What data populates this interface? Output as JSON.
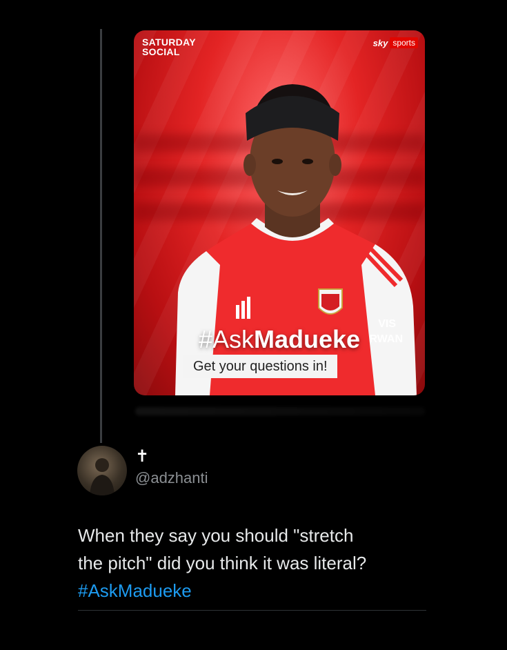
{
  "card": {
    "brand_line1": "SATURDAY",
    "brand_line2": "SOCIAL",
    "sky_label": "sky",
    "sports_label": "sports",
    "hashtag_prefix": "#Ask",
    "hashtag_name": "Madueke",
    "subtitle": "Get your questions in!",
    "shirt_sponsor": "VIS RWAN",
    "badge": "Arsenal"
  },
  "tweet": {
    "display_name": "✝",
    "handle": "@adzhanti",
    "text_line1": "When they say you should \"stretch",
    "text_line2": "the pitch\" did you think it was literal?",
    "hashtag": "#AskMadueke"
  },
  "colors": {
    "background": "#000000",
    "hashtag_link": "#1d9bf0",
    "card_red": "#e32424"
  }
}
